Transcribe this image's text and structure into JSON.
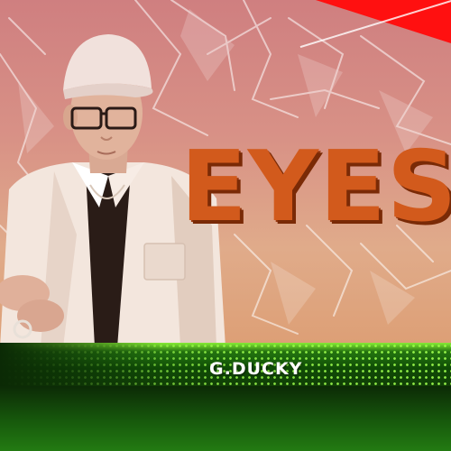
{
  "cover": {
    "title": "EYES",
    "artist": "G.DUCKY"
  },
  "colors": {
    "title_orange": "#d25a1c",
    "accent_red": "#ff1010",
    "band_green": "#1f6d0e",
    "background_pink": "#d89186"
  },
  "icons": {
    "corner": "red-corner-ribbon",
    "texture": "plastic-wrap-texture"
  }
}
